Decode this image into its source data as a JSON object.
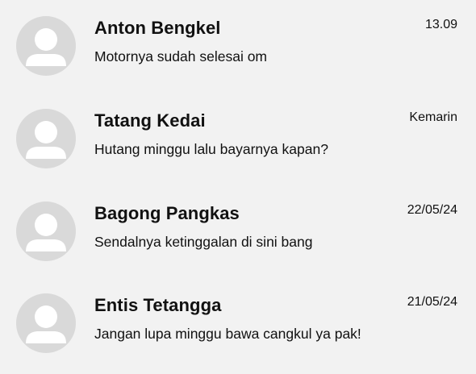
{
  "chats": [
    {
      "name": "Anton Bengkel",
      "time": "13.09",
      "message": "Motornya sudah selesai om",
      "avatar_icon": "user-placeholder-icon"
    },
    {
      "name": "Tatang Kedai",
      "time": "Kemarin",
      "message": "Hutang minggu lalu bayarnya kapan?",
      "avatar_icon": "user-placeholder-icon"
    },
    {
      "name": "Bagong Pangkas",
      "time": "22/05/24",
      "message": "Sendalnya ketinggalan di sini bang",
      "avatar_icon": "user-placeholder-icon"
    },
    {
      "name": "Entis Tetangga",
      "time": "21/05/24",
      "message": "Jangan lupa minggu bawa cangkul ya pak!",
      "avatar_icon": "user-placeholder-icon"
    }
  ],
  "colors": {
    "background": "#f2f2f2",
    "avatar_bg": "#d9d9d9",
    "avatar_figure": "#ffffff",
    "text": "#111111"
  }
}
